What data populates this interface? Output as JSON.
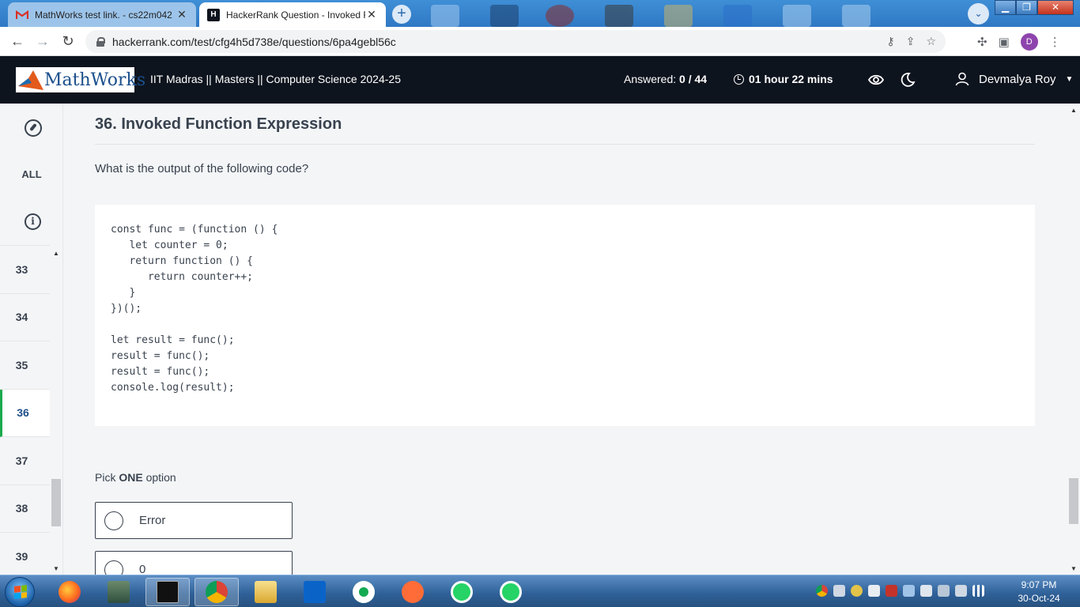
{
  "browser": {
    "tabs": [
      {
        "title": "MathWorks test link. - cs22m042",
        "close": "✕",
        "favicon": "gmail-icon",
        "active": false
      },
      {
        "title": "HackerRank Question - Invoked F",
        "close": "✕",
        "favicon": "hackerrank-icon",
        "active": true
      }
    ],
    "new_tab": "+",
    "tab_search": "⌄",
    "window_buttons": {
      "minimize": "▁",
      "restore": "❐",
      "close": "✕"
    },
    "url": "hackerrank.com/test/cfg4h5d738e/questions/6pa4gebl56c",
    "profile_initial": "D"
  },
  "header": {
    "logo_text": "MathWorks",
    "test_title": "IIT Madras || Masters || Computer Science 2024-25",
    "answered_label": "Answered:",
    "answered_value": "0 / 44",
    "timer": "01 hour 22 mins",
    "user_name": "Devmalya Roy"
  },
  "sidebar": {
    "all_label": "ALL",
    "questions": [
      "33",
      "34",
      "35",
      "36",
      "37",
      "38",
      "39"
    ],
    "current": "36"
  },
  "question": {
    "title": "36. Invoked Function Expression",
    "prompt": "What is the output of the following code?",
    "code": [
      "const func = (function () {",
      "   let counter = 0;",
      "   return function () {",
      "      return counter++;",
      "   }",
      "})();",
      "",
      "let result = func();",
      "result = func();",
      "result = func();",
      "console.log(result);"
    ],
    "pick_prefix": "Pick",
    "pick_bold": "ONE",
    "pick_suffix": "option",
    "options": [
      "Error",
      "0"
    ]
  },
  "taskbar": {
    "time": "9:07 PM",
    "date": "30-Oct-24"
  },
  "colors": {
    "header_bg": "#0e141e",
    "accent_green": "#1ba94c",
    "text_dark": "#39424e",
    "tabstrip": "#2f78c4"
  }
}
